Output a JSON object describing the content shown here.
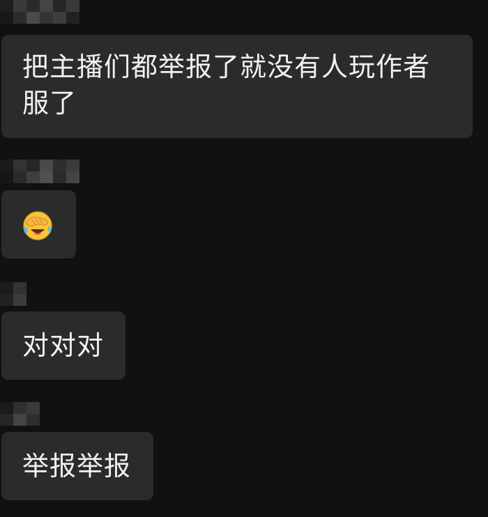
{
  "messages": [
    {
      "lines": [
        "把主播们都举报了就没有人玩作者",
        "服了"
      ]
    },
    {
      "emoji": "face-with-hand-over-eyes-laughing-crying-emoji"
    },
    {
      "text": "对对对"
    },
    {
      "text": "举报举报"
    }
  ],
  "colors": {
    "background": "#111111",
    "bubble": "#2b2b2b",
    "text": "#f1f1f1",
    "emoji_face": "#f7c53a"
  }
}
